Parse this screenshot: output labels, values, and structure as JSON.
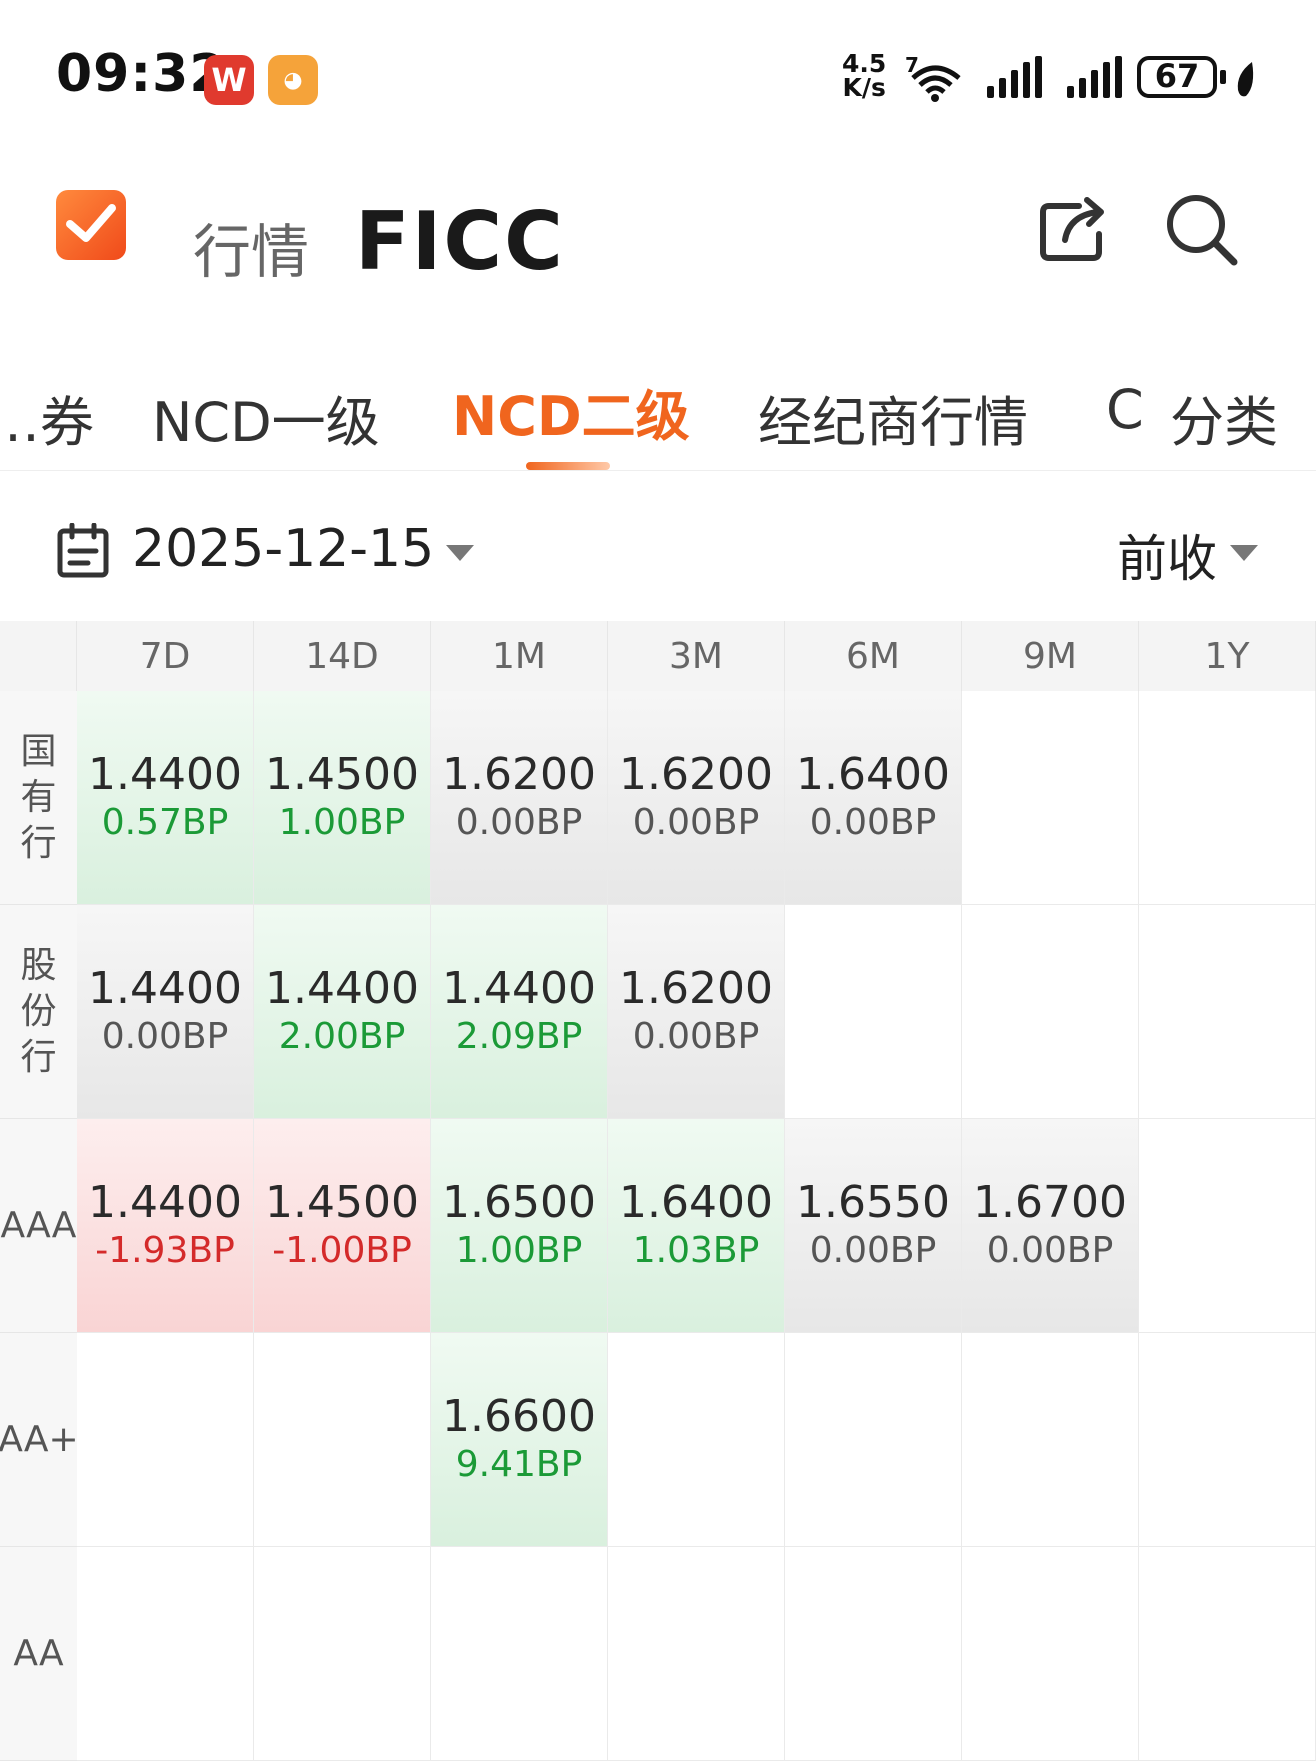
{
  "status_bar": {
    "time": "09:32",
    "app_icon_1": "W",
    "net_speed_value": "4.5",
    "net_speed_unit": "K/s",
    "wifi_badge": "7",
    "battery_level": "67"
  },
  "header": {
    "section_label": "行情",
    "title": "FICC",
    "icons": [
      "check-logo-icon",
      "share-icon",
      "search-icon"
    ]
  },
  "tabs": [
    {
      "label": "…券"
    },
    {
      "label": "NCD一级"
    },
    {
      "label": "NCD二级",
      "active": true
    },
    {
      "label": "经纪商行情"
    },
    {
      "label": "C"
    },
    {
      "label": "分类"
    }
  ],
  "filter": {
    "date": "2025-12-15",
    "sort": "前收"
  },
  "table": {
    "columns": [
      "7D",
      "14D",
      "1M",
      "3M",
      "6M",
      "9M",
      "1Y"
    ],
    "rows": [
      {
        "label": "国\n有\n行",
        "cells": [
          {
            "value": "1.4400",
            "change": "0.57BP",
            "trend": "up"
          },
          {
            "value": "1.4500",
            "change": "1.00BP",
            "trend": "up"
          },
          {
            "value": "1.6200",
            "change": "0.00BP",
            "trend": "neutral"
          },
          {
            "value": "1.6200",
            "change": "0.00BP",
            "trend": "neutral"
          },
          {
            "value": "1.6400",
            "change": "0.00BP",
            "trend": "neutral"
          },
          null,
          null
        ]
      },
      {
        "label": "股\n份\n行",
        "cells": [
          {
            "value": "1.4400",
            "change": "0.00BP",
            "trend": "neutral"
          },
          {
            "value": "1.4400",
            "change": "2.00BP",
            "trend": "up"
          },
          {
            "value": "1.4400",
            "change": "2.09BP",
            "trend": "up"
          },
          {
            "value": "1.6200",
            "change": "0.00BP",
            "trend": "neutral"
          },
          null,
          null,
          null
        ]
      },
      {
        "label": "AAA",
        "cells": [
          {
            "value": "1.4400",
            "change": "-1.93BP",
            "trend": "down"
          },
          {
            "value": "1.4500",
            "change": "-1.00BP",
            "trend": "down"
          },
          {
            "value": "1.6500",
            "change": "1.00BP",
            "trend": "up"
          },
          {
            "value": "1.6400",
            "change": "1.03BP",
            "trend": "up"
          },
          {
            "value": "1.6550",
            "change": "0.00BP",
            "trend": "neutral"
          },
          {
            "value": "1.6700",
            "change": "0.00BP",
            "trend": "neutral"
          },
          null
        ]
      },
      {
        "label": "AA+",
        "cells": [
          null,
          null,
          {
            "value": "1.6600",
            "change": "9.41BP",
            "trend": "up"
          },
          null,
          null,
          null,
          null
        ]
      },
      {
        "label": "AA",
        "cells": [
          null,
          null,
          null,
          null,
          null,
          null,
          null
        ]
      }
    ]
  },
  "colors": {
    "accent": "#f0651e",
    "up": "#1b9a37",
    "down": "#d42a2a"
  }
}
